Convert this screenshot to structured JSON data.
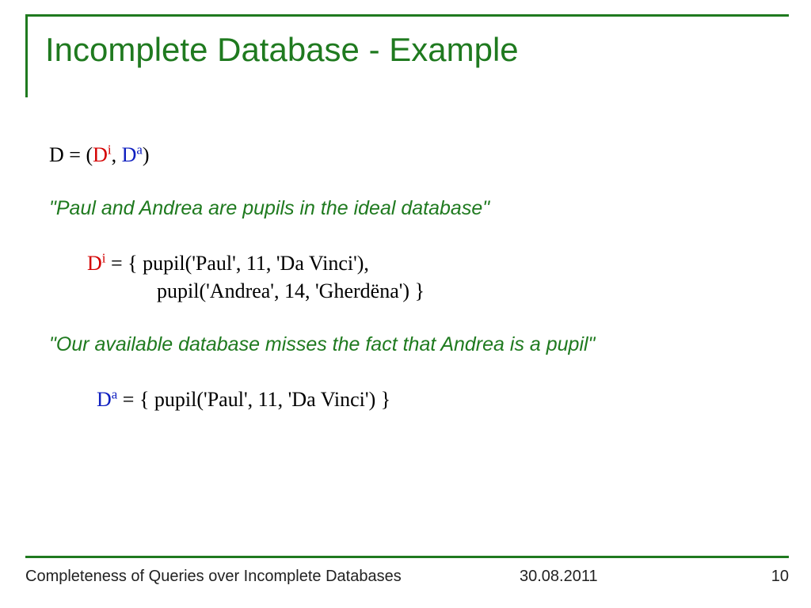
{
  "title": "Incomplete Database - Example",
  "defPrefix": "D = (",
  "defDi_base": "D",
  "defDi_sup": "i",
  "defSep": ", ",
  "defDa_base": "D",
  "defDa_sup": "a",
  "defSuffix": ")",
  "quote1": "\"Paul and Andrea are pupils in the ideal database\"",
  "di_base": "D",
  "di_sup": "i",
  "di_line1_rest": " = { pupil('Paul', 11, 'Da Vinci'),",
  "di_line2": "pupil('Andrea', 14, 'Gherdëna') }",
  "quote2": "\"Our available database misses the fact that Andrea is a pupil\"",
  "da_base": "D",
  "da_sup": "a",
  "da_rest": " = { pupil('Paul', 11, 'Da Vinci') }",
  "footer": {
    "title": "Completeness of Queries over Incomplete Databases",
    "date": "30.08.2011",
    "page": "10"
  }
}
